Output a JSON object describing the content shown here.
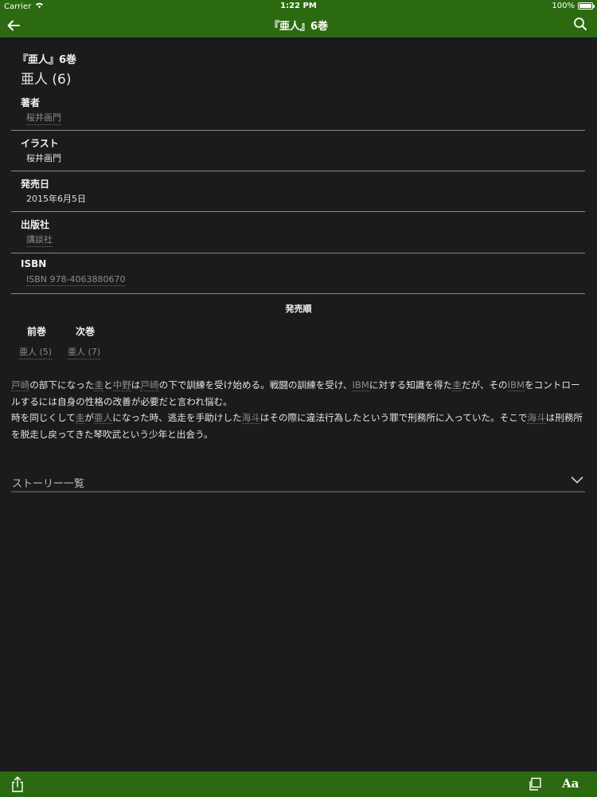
{
  "status_bar": {
    "carrier": "Carrier",
    "time": "1:22 PM",
    "battery": "100%",
    "wifi_icon": "wifi-icon",
    "battery_icon": "battery-icon"
  },
  "nav": {
    "title": "『亜人』6巻",
    "back_icon": "back-arrow-icon",
    "search_icon": "search-icon"
  },
  "book": {
    "title": "『亜人』6巻",
    "subtitle": "亜人 (6)"
  },
  "fields": {
    "author": {
      "label": "著者",
      "value": "桜井画門"
    },
    "illustrator": {
      "label": "イラスト",
      "value": "桜井画門"
    },
    "release_date": {
      "label": "発売日",
      "value": "2015年6月5日"
    },
    "publisher": {
      "label": "出版社",
      "value": "講談社"
    },
    "isbn": {
      "label": "ISBN",
      "value": "ISBN 978-4063880670"
    }
  },
  "release_order": {
    "heading": "発売順",
    "prev_label": "前巻",
    "next_label": "次巻",
    "prev_value": "亜人 (5)",
    "next_value": "亜人 (7)"
  },
  "description": {
    "p1": [
      "",
      "戸崎",
      "の部下になった",
      "圭",
      "と",
      "中野",
      "は",
      "戸崎",
      "の下で訓練を受け始める。戦闘の訓練を受け、",
      "IBM",
      "に対する知識を得た",
      "圭",
      "だが、その",
      "IBM",
      "をコントロールするには自身の性格の改善が必要だと言われ悩む。"
    ],
    "p2": [
      "時を同じくして",
      "圭",
      "が",
      "亜人",
      "になった時、逃走を手助けした",
      "海斗",
      "はその際に違法行為したという罪で刑務所に入っていた。そこで",
      "海斗",
      "は刑務所を脱走し戻ってきた琴吹武という少年と出会う。"
    ]
  },
  "story_list": {
    "label": "ストーリー一覧",
    "chevron_icon": "chevron-down-icon"
  },
  "toolbar": {
    "share_icon": "share-icon",
    "copy_icon": "copy-icon",
    "text_size_label": "Aa"
  },
  "colors": {
    "header_green": "#2c6a11",
    "background": "#1b1a1c",
    "link_gray": "#8c8c8c"
  }
}
